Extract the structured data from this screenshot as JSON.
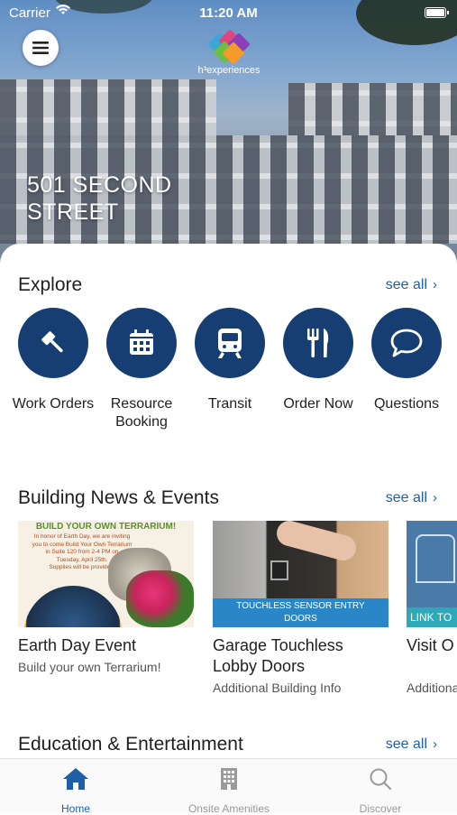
{
  "status": {
    "carrier": "Carrier",
    "time": "11:20 AM"
  },
  "header": {
    "logo_text": "h³experiences",
    "address_line1": "501 SECOND",
    "address_line2": "STREET"
  },
  "explore": {
    "title": "Explore",
    "see_all": "see all",
    "items": [
      {
        "label_line1": "Work Orders",
        "label_line2": "",
        "icon": "gavel-icon"
      },
      {
        "label_line1": "Resource",
        "label_line2": "Booking",
        "icon": "calendar-icon"
      },
      {
        "label_line1": "Transit",
        "label_line2": "",
        "icon": "train-icon"
      },
      {
        "label_line1": "Order Now",
        "label_line2": "",
        "icon": "fork-knife-icon"
      },
      {
        "label_line1": "Questions",
        "label_line2": "",
        "icon": "chat-bubble-icon"
      }
    ]
  },
  "news": {
    "title": "Building News & Events",
    "see_all": "see all",
    "cards": [
      {
        "title_line1": "Earth Day Event",
        "title_line2": "",
        "subtitle": "Build your own Terrarium!",
        "image_heading": "BUILD YOUR OWN TERRARIUM!",
        "image_text_lines": [
          "In honor of Earth Day, we are inviting",
          "you to come Build Your Own Terrarium",
          "in Suite 120 from 2-4 PM on",
          "Tuesday, April 25th.",
          "Supplies will be provided."
        ]
      },
      {
        "title_line1": "Garage Touchless",
        "title_line2": "Lobby Doors",
        "subtitle": "Additional Building Info",
        "image_banner_line1": "TOUCHLESS SENSOR ENTRY",
        "image_banner_line2": "DOORS"
      },
      {
        "title_line1": "Visit O",
        "title_line2": "",
        "subtitle": "Additiona",
        "image_banner": "LINK TO"
      }
    ]
  },
  "education": {
    "title": "Education & Entertainment",
    "see_all": "see all"
  },
  "tabs": [
    {
      "label": "Home",
      "icon": "home-icon",
      "active": true
    },
    {
      "label": "Onsite Amenities",
      "icon": "building-icon",
      "active": false
    },
    {
      "label": "Discover",
      "icon": "search-icon",
      "active": false
    }
  ],
  "colors": {
    "accent": "#1f5fa8",
    "circle": "#163e73"
  }
}
